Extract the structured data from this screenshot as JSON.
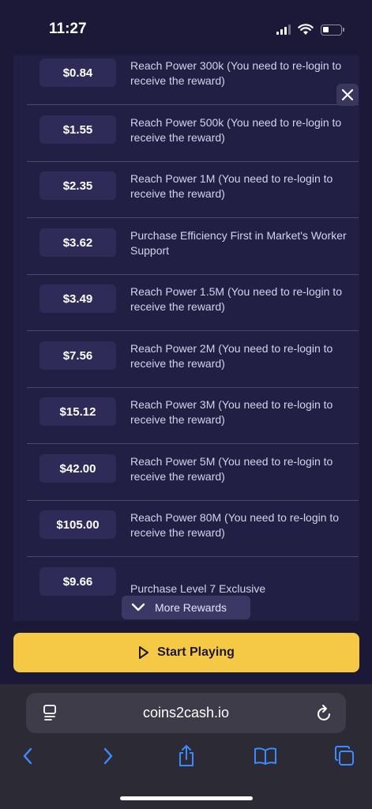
{
  "status_bar": {
    "time": "11:27"
  },
  "rewards": [
    {
      "price": "$0.84",
      "description": "Reach Power 300k (You need to re-login to receive the reward)"
    },
    {
      "price": "$1.55",
      "description": "Reach Power 500k (You need to re-login to receive the reward)"
    },
    {
      "price": "$2.35",
      "description": "Reach Power 1M (You need to re-login to receive the reward)"
    },
    {
      "price": "$3.62",
      "description": "Purchase Efficiency First in Market's Worker Support"
    },
    {
      "price": "$3.49",
      "description": "Reach Power 1.5M (You need to re-login to receive the reward)"
    },
    {
      "price": "$7.56",
      "description": "Reach Power 2M (You need to re-login to receive the reward)"
    },
    {
      "price": "$15.12",
      "description": "Reach Power 3M (You need to re-login to receive the reward)"
    },
    {
      "price": "$42.00",
      "description": "Reach Power 5M (You need to re-login to receive the reward)"
    },
    {
      "price": "$105.00",
      "description": "Reach Power 80M (You need to re-login to receive the reward)"
    },
    {
      "price": "$9.66",
      "description": "Purchase Level 7 Exclusive"
    }
  ],
  "more_rewards_label": "More Rewards",
  "start_button_label": "Start Playing",
  "browser": {
    "url": "coins2cash.io"
  },
  "icons": {
    "close": "close-icon",
    "chevron": "chevron-down-icon",
    "play": "play-icon",
    "reader": "reader-mode-icon",
    "reload": "reload-icon",
    "back": "back-arrow-icon",
    "forward": "forward-arrow-icon",
    "share": "share-icon",
    "bookmarks": "bookmarks-icon",
    "tabs": "tabs-icon"
  },
  "colors": {
    "accent": "#f5c945",
    "background": "#1b1838",
    "panel": "#221f45"
  }
}
